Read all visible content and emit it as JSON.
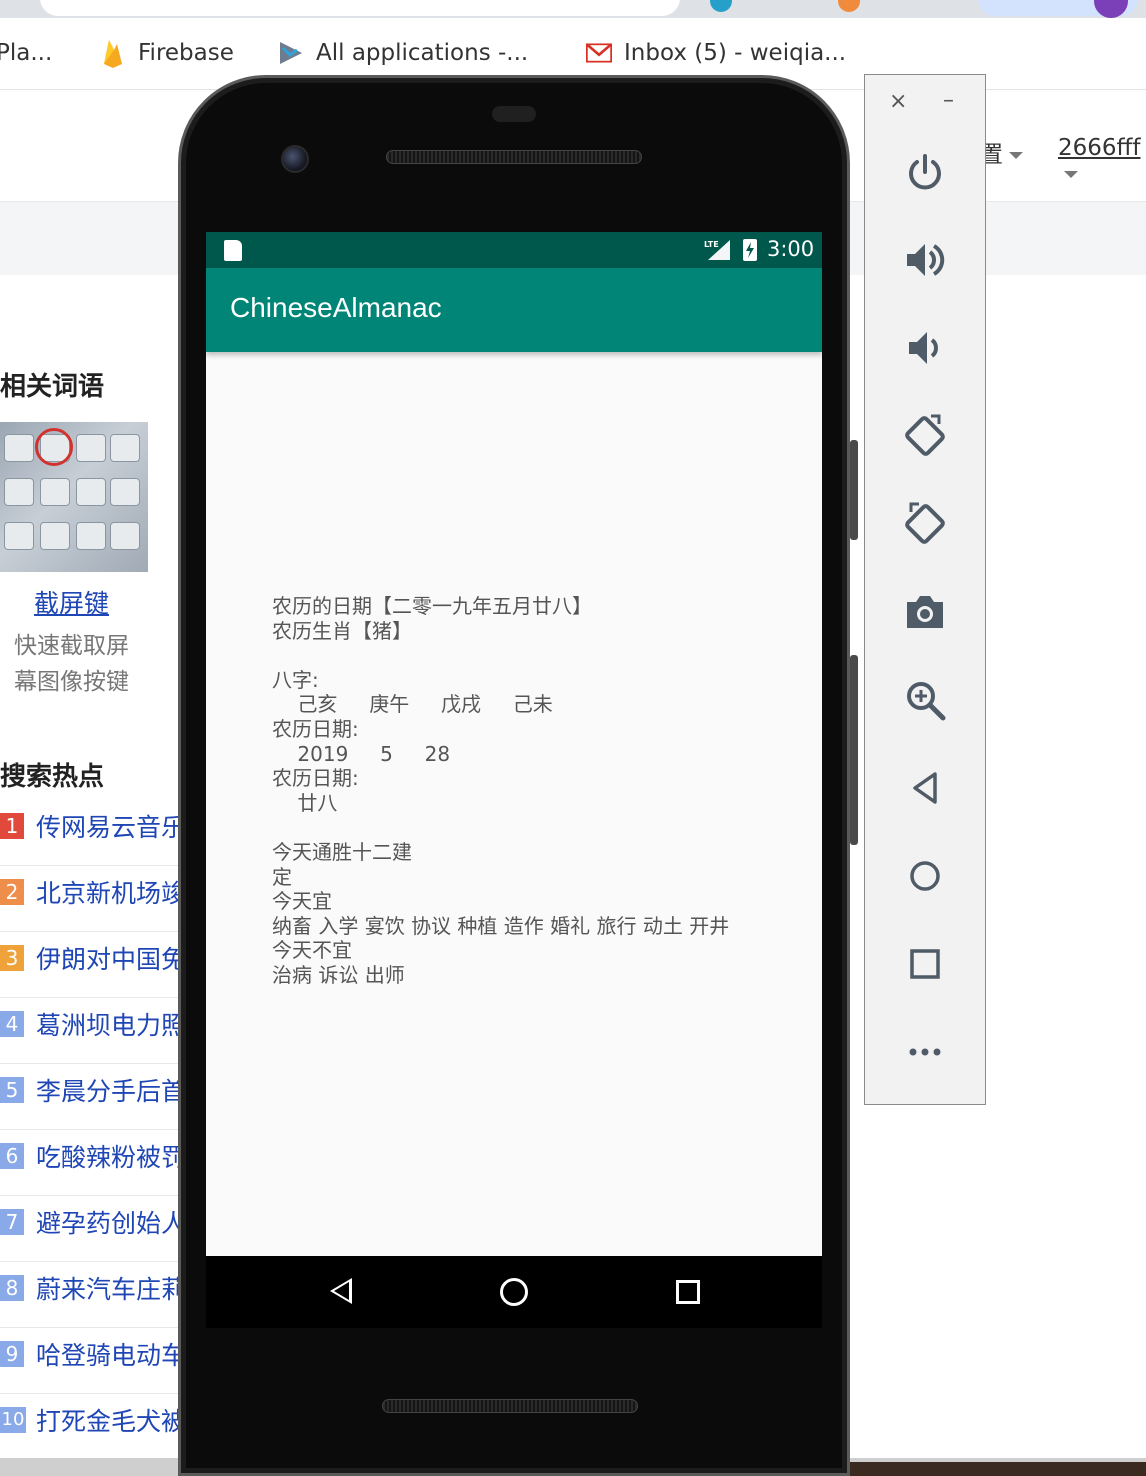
{
  "browser": {
    "bookmarks": [
      {
        "label": "Pla...",
        "icon": "play-store-icon"
      },
      {
        "label": "Firebase",
        "icon": "firebase-icon"
      },
      {
        "label": "All applications -...",
        "icon": "play-console-icon"
      },
      {
        "label": "Inbox (5) - weiqia...",
        "icon": "gmail-icon"
      }
    ]
  },
  "webpage": {
    "settings_label": "置",
    "username": "2666fff",
    "related_title": "相关词语",
    "related_item": {
      "title": "截屏键",
      "desc": "快速截取屏幕图像按键"
    },
    "hot_title": "搜索热点",
    "hot_items": [
      {
        "num": "1",
        "text": "传网易云音乐",
        "color": "#e0493c"
      },
      {
        "num": "2",
        "text": "北京新机场竣",
        "color": "#ef8d4b"
      },
      {
        "num": "3",
        "text": "伊朗对中国免",
        "color": "#f0a23a"
      },
      {
        "num": "4",
        "text": "葛洲坝电力照",
        "color": "#8aa9e8"
      },
      {
        "num": "5",
        "text": "李晨分手后首",
        "color": "#8aa9e8"
      },
      {
        "num": "6",
        "text": "吃酸辣粉被罚",
        "color": "#8aa9e8"
      },
      {
        "num": "7",
        "text": "避孕药创始人",
        "color": "#8aa9e8"
      },
      {
        "num": "8",
        "text": "蔚来汽车庄莉",
        "color": "#8aa9e8"
      },
      {
        "num": "9",
        "text": "哈登骑电动车",
        "color": "#8aa9e8"
      },
      {
        "num": "10",
        "text": "打死金毛犬被",
        "color": "#8aa9e8"
      }
    ]
  },
  "device": {
    "status_time": "3:00",
    "status_network": "LTE",
    "app_title": "ChineseAlmanac",
    "colors": {
      "status_bar": "#00574b",
      "app_bar": "#008577"
    },
    "almanac_text": "农历的日期【二零一九年五月廿八】\n农历生肖【猪】\n\n八字:\n    己亥     庚午     戊戌     己未\n农历日期:\n    2019     5     28\n农历日期:\n    廿八\n\n今天通胜十二建\n定\n今天宜\n纳畜 入学 宴饮 协议 种植 造作 婚礼 旅行 动土 开井\n今天不宜\n治病 诉讼 出师"
  },
  "emulator_toolbar": {
    "close": "×",
    "minimize": "–",
    "buttons": [
      "power-icon",
      "volume-up-icon",
      "volume-down-icon",
      "rotate-left-icon",
      "rotate-right-icon",
      "camera-icon",
      "zoom-icon",
      "back-icon",
      "home-icon",
      "overview-icon",
      "more-icon"
    ]
  }
}
